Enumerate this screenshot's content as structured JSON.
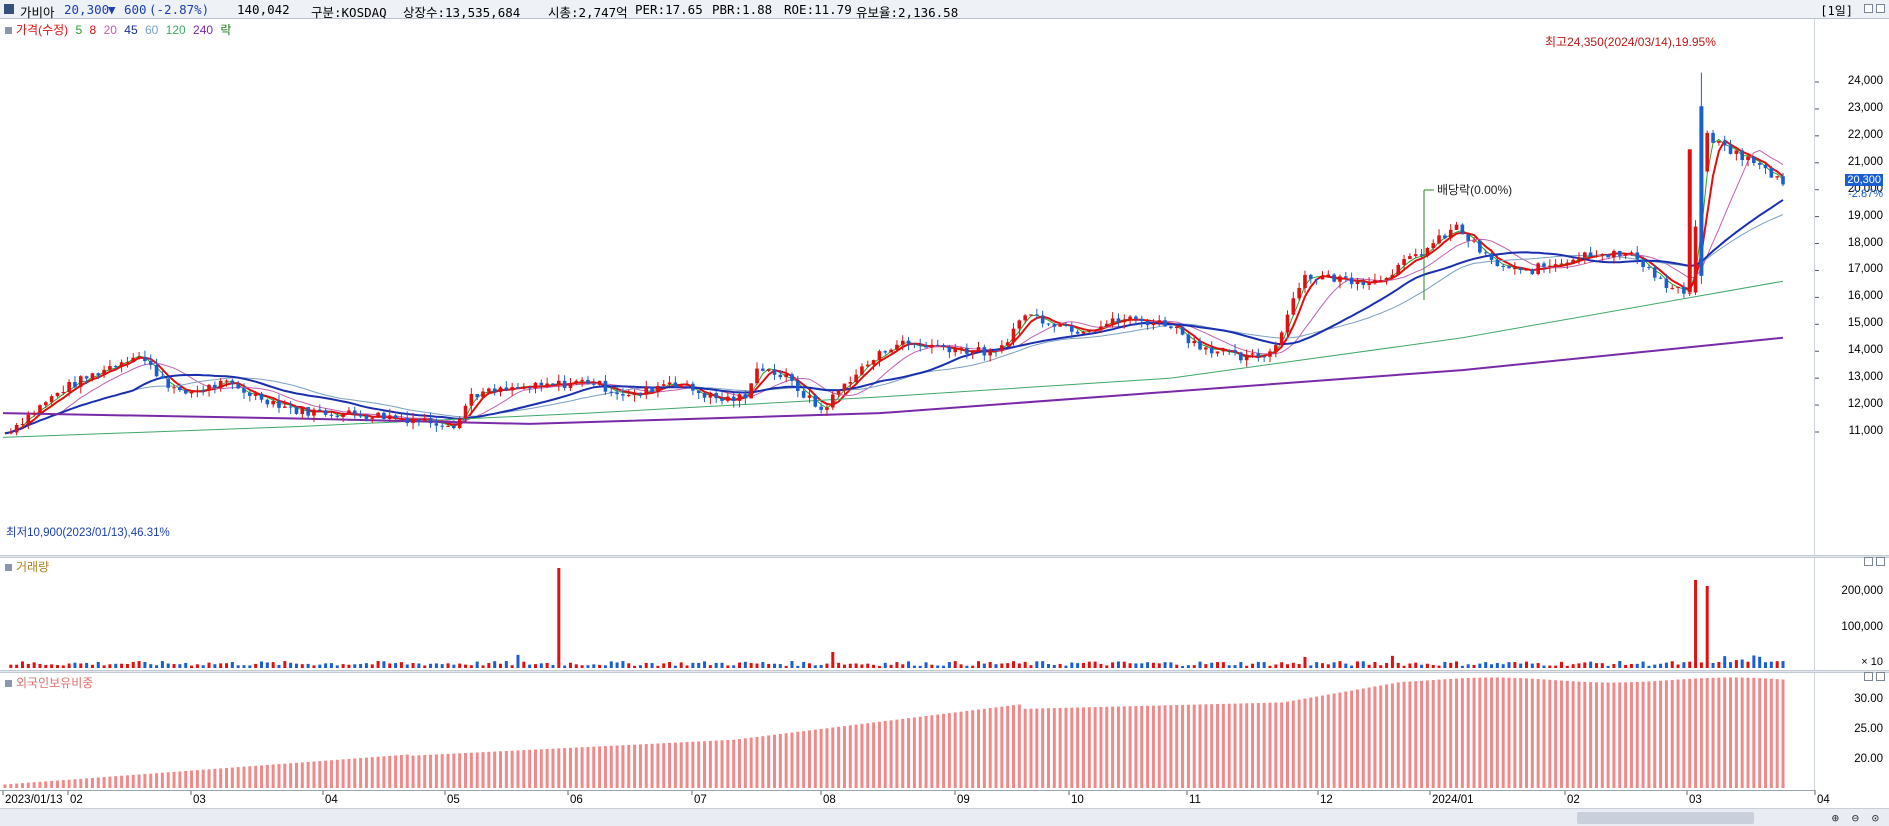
{
  "header": {
    "stock_name": "가비아",
    "price": "20,300",
    "change_arrow": "▼",
    "change": "600",
    "change_pct": "(-2.87%)",
    "volume": "140,042",
    "market": "구분:KOSDAQ",
    "shares": "상장수:13,535,684",
    "market_cap": "시총:2,747억",
    "per": "PER:17.65",
    "pbr": "PBR:1.88",
    "roe": "ROE:11.79",
    "holdings": "유보율:2,136.58",
    "timeframe": "[1일]"
  },
  "price_panel": {
    "legend": {
      "price_label": "가격(수정)",
      "ma": [
        "5",
        "8",
        "20",
        "45",
        "60",
        "120",
        "240"
      ],
      "ex_label": "락"
    },
    "high_note": "최고24,350(2024/03/14),19.95%",
    "low_note": "최저10,900(2023/01/13),46.31%",
    "dividend_note": "배당락(0.00%)",
    "current_price_tag": "20,300",
    "current_change_tag": "-2.87%",
    "y_ticks": [
      "24,000",
      "23,000",
      "22,000",
      "21,000",
      "20,000",
      "19,000",
      "18,000",
      "17,000",
      "16,000",
      "15,000",
      "14,000",
      "13,000",
      "12,000",
      "11,000"
    ]
  },
  "volume_panel": {
    "legend": "거래량",
    "y_ticks": [
      "200,000",
      "100,000"
    ],
    "unit": "× 10"
  },
  "foreign_panel": {
    "legend": "외국인보유비중",
    "y_ticks": [
      "30.00",
      "25.00",
      "20.00"
    ]
  },
  "x_axis": {
    "labels": [
      "2023/01/13",
      "02",
      "03",
      "04",
      "05",
      "06",
      "07",
      "08",
      "09",
      "10",
      "11",
      "12",
      "2024/01",
      "02",
      "03",
      "04"
    ]
  },
  "colors": {
    "up": "#e01010",
    "down": "#1a5fd0",
    "ma5": "#2aa02a",
    "ma8": "#e01010",
    "ma20": "#c060b0",
    "ma45": "#1a2fb0",
    "ma60": "#7aa0c0",
    "ma120": "#3fa86a",
    "ma240": "#7a2aa8"
  },
  "icons": {
    "panel": "panel-square-icon",
    "zoom_in": "zoom-in-icon",
    "zoom_out": "zoom-out-icon",
    "zoom_reset": "zoom-reset-icon"
  }
}
